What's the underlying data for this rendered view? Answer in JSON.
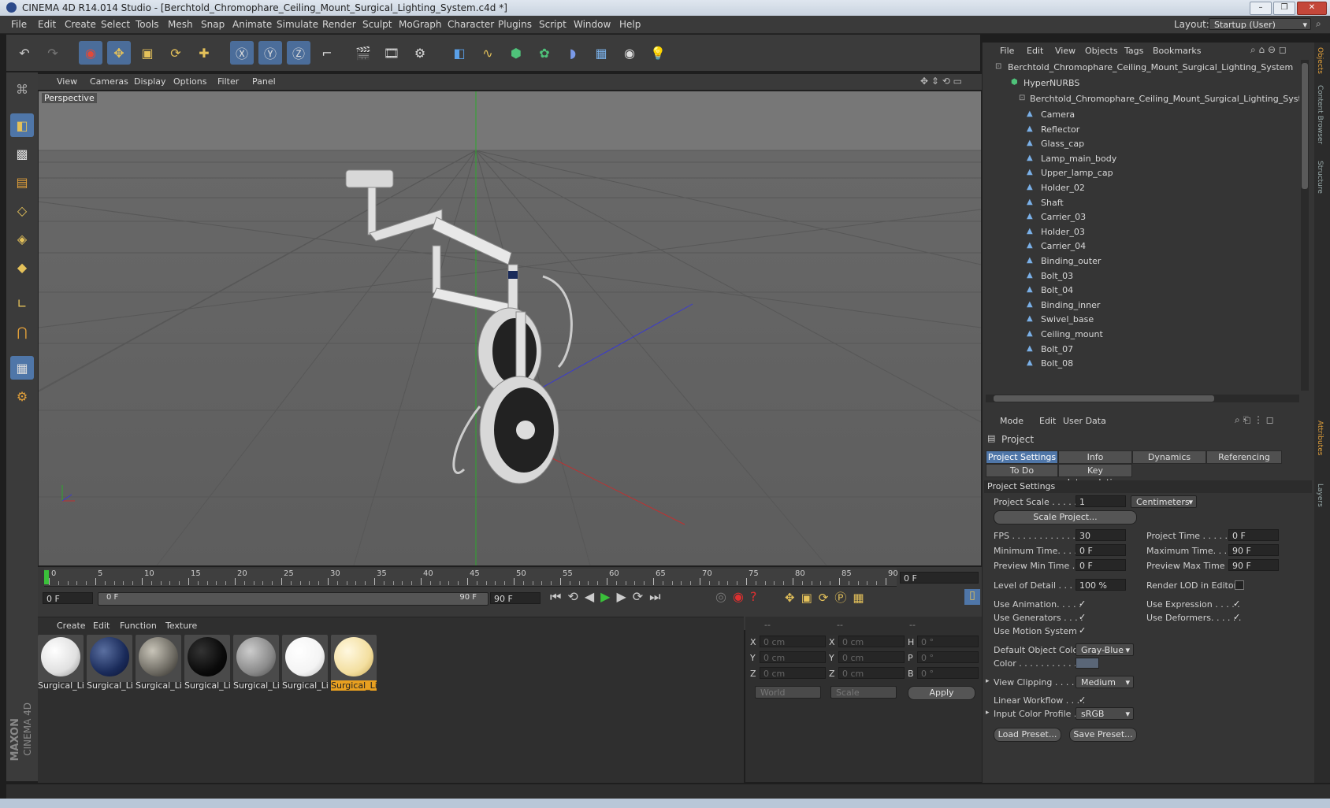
{
  "window": {
    "title": "CINEMA 4D R14.014 Studio - [Berchtold_Chromophare_Ceiling_Mount_Surgical_Lighting_System.c4d *]"
  },
  "menubar": {
    "items": [
      "File",
      "Edit",
      "Create",
      "Select",
      "Tools",
      "Mesh",
      "Snap",
      "Animate",
      "Simulate",
      "Render",
      "Sculpt",
      "MoGraph",
      "Character",
      "Plugins",
      "Script",
      "Window",
      "Help"
    ],
    "layout_label": "Layout:",
    "layout_value": "Startup (User)"
  },
  "viewport": {
    "menu": [
      "View",
      "Cameras",
      "Display",
      "Options",
      "Filter",
      "Panel"
    ],
    "label": "Perspective"
  },
  "timeline": {
    "ticks": [
      "0",
      "5",
      "10",
      "15",
      "20",
      "25",
      "30",
      "35",
      "40",
      "45",
      "50",
      "55",
      "60",
      "65",
      "70",
      "75",
      "80",
      "85",
      "90"
    ],
    "current_frame": "0 F",
    "start": "0 F",
    "range_start": "0 F",
    "range_end": "90 F",
    "end": "90 F"
  },
  "material_manager": {
    "menu": [
      "Create",
      "Edit",
      "Function",
      "Texture"
    ],
    "materials": [
      {
        "name": "Surgical_Li",
        "color": "#e0e0e0"
      },
      {
        "name": "Surgical_Li",
        "color": "#1a2b5a"
      },
      {
        "name": "Surgical_Li",
        "color": "#6d6a62"
      },
      {
        "name": "Surgical_Li",
        "color": "#0a0a0a"
      },
      {
        "name": "Surgical_Li",
        "color": "#8a8a8a"
      },
      {
        "name": "Surgical_Li",
        "color": "#ffffff"
      },
      {
        "name": "Surgical_Li",
        "color": "#f3dfa0"
      }
    ]
  },
  "coordinates": {
    "headers": [
      "--",
      "--",
      "--"
    ],
    "rows": [
      {
        "a": "X",
        "av": "0 cm",
        "b": "X",
        "bv": "0 cm",
        "c": "H",
        "cv": "0 °"
      },
      {
        "a": "Y",
        "av": "0 cm",
        "b": "Y",
        "bv": "0 cm",
        "c": "P",
        "cv": "0 °"
      },
      {
        "a": "Z",
        "av": "0 cm",
        "b": "Z",
        "bv": "0 cm",
        "c": "B",
        "cv": "0 °"
      }
    ],
    "space": "World",
    "mode": "Scale",
    "apply": "Apply"
  },
  "object_manager": {
    "menu": [
      "File",
      "Edit",
      "View",
      "Objects",
      "Tags",
      "Bookmarks"
    ],
    "root": "Berchtold_Chromophare_Ceiling_Mount_Surgical_Lighting_System",
    "hypernurbs": "HyperNURBS",
    "group": "Berchtold_Chromophare_Ceiling_Mount_Surgical_Lighting_System",
    "children": [
      "Camera",
      "Reflector",
      "Glass_cap",
      "Lamp_main_body",
      "Upper_lamp_cap",
      "Holder_02",
      "Shaft",
      "Carrier_03",
      "Holder_03",
      "Carrier_04",
      "Binding_outer",
      "Bolt_03",
      "Bolt_04",
      "Binding_inner",
      "Swivel_base",
      "Ceiling_mount",
      "Bolt_07",
      "Bolt_08"
    ]
  },
  "attributes": {
    "menu": [
      "Mode",
      "Edit",
      "User Data"
    ],
    "title": "Project",
    "tabs_row1": [
      "Project Settings",
      "Info",
      "Dynamics",
      "Referencing"
    ],
    "tabs_row2": [
      "To Do",
      "Key Interpolation"
    ],
    "section": "Project Settings",
    "project_scale_label": "Project Scale . . . . . .",
    "project_scale_value": "1",
    "project_scale_unit": "Centimeters",
    "scale_project_btn": "Scale Project...",
    "fps_label": "FPS . . . . . . . . . . . . . .",
    "fps_value": "30",
    "project_time_label": "Project Time . . . . . . .",
    "project_time_value": "0 F",
    "min_time_label": "Minimum Time. . . . .",
    "min_time_value": "0 F",
    "max_time_label": "Maximum Time. . . . .",
    "max_time_value": "90 F",
    "prev_min_label": "Preview Min Time . .",
    "prev_min_value": "0 F",
    "prev_max_label": "Preview Max Time . .",
    "prev_max_value": "90 F",
    "lod_label": "Level of Detail . . . . .",
    "lod_value": "100 %",
    "render_lod_label": "Render LOD in Editor",
    "use_anim_label": "Use Animation. . . . .",
    "use_expr_label": "Use Expression . . . . .",
    "use_gen_label": "Use Generators . . . .",
    "use_def_label": "Use Deformers. . . . . .",
    "use_motion_label": "Use Motion System",
    "def_obj_color_label": "Default Object Color",
    "def_obj_color_value": "Gray-Blue",
    "color_label": "Color . . . . . . . . . . .",
    "view_clip_label": "View Clipping . . . . . .",
    "view_clip_value": "Medium",
    "linear_label": "Linear Workflow . . . .",
    "icp_label": "Input Color Profile . .",
    "icp_value": "sRGB",
    "load_preset": "Load Preset...",
    "save_preset": "Save Preset...",
    "checkmark": "✓"
  },
  "right_strip": [
    "Objects",
    "Content Browser",
    "Structure",
    "Attributes",
    "Layers"
  ],
  "brand": {
    "maxon": "MAXON",
    "cinema": "CINEMA 4D"
  },
  "colors": {
    "accent": "#4f76a8",
    "panel": "#353535"
  }
}
